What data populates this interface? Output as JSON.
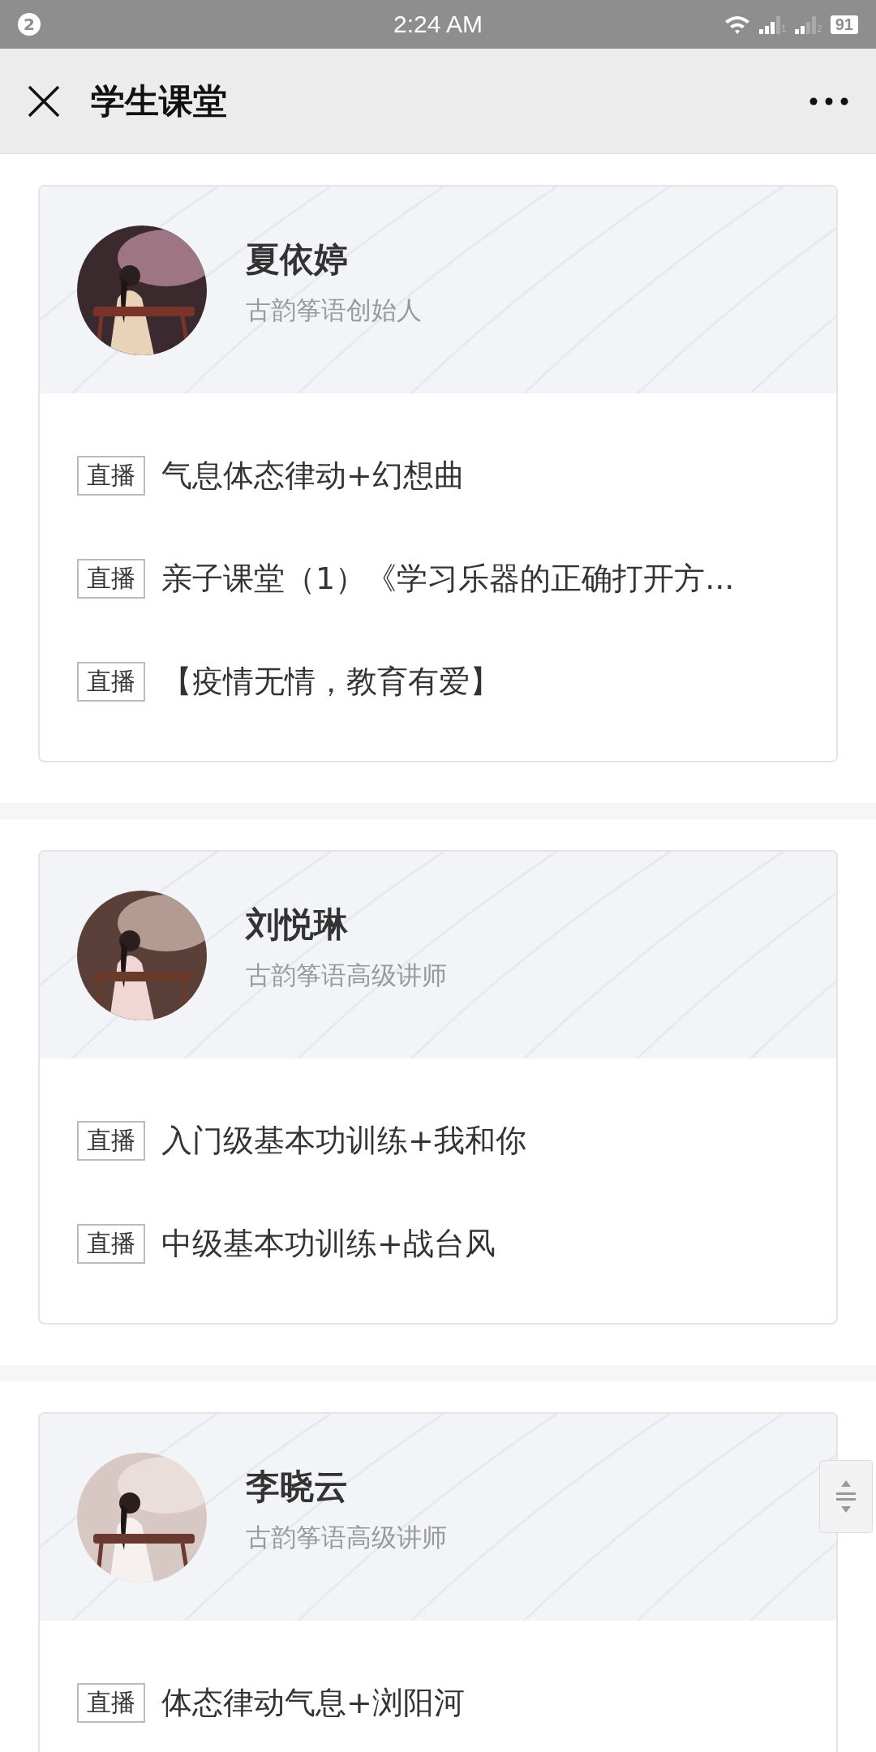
{
  "status_bar": {
    "notification_count": "2",
    "time": "2:24 AM",
    "sim_1": "1",
    "sim_2": "2",
    "battery": "91"
  },
  "app_bar": {
    "title": "学生课堂"
  },
  "teachers": [
    {
      "name": "夏依婷",
      "role": "古韵筝语创始人",
      "avatar": {
        "kind": "picture"
      },
      "lessons": [
        {
          "tag": "直播",
          "title": "气息体态律动+幻想曲"
        },
        {
          "tag": "直播",
          "title": "亲子课堂（1）《学习乐器的正确打开方..."
        },
        {
          "tag": "直播",
          "title": "【疫情无情，教育有爱】"
        }
      ]
    },
    {
      "name": "刘悦琳",
      "role": "古韵筝语高级讲师",
      "avatar": {
        "kind": "picture"
      },
      "lessons": [
        {
          "tag": "直播",
          "title": "入门级基本功训练+我和你"
        },
        {
          "tag": "直播",
          "title": "中级基本功训练+战台风"
        }
      ]
    },
    {
      "name": "李晓云",
      "role": "古韵筝语高级讲师",
      "avatar": {
        "kind": "picture"
      },
      "lessons": [
        {
          "tag": "直播",
          "title": "体态律动气息+浏阳河"
        }
      ]
    }
  ]
}
